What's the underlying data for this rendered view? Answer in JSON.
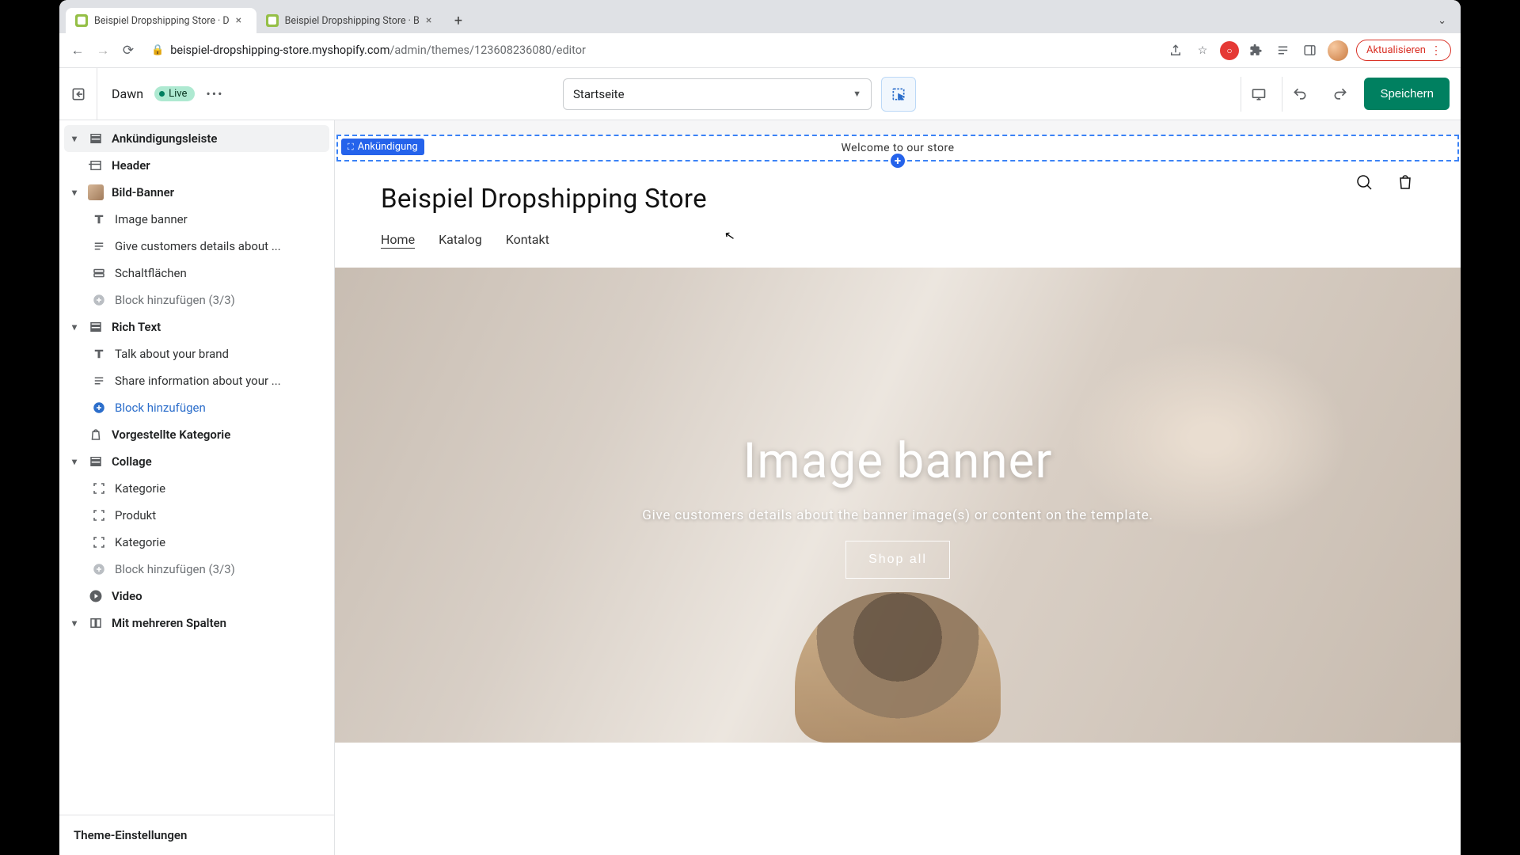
{
  "browser": {
    "tabs": [
      {
        "title": "Beispiel Dropshipping Store · D",
        "active": true
      },
      {
        "title": "Beispiel Dropshipping Store · B",
        "active": false
      }
    ],
    "url_domain": "beispiel-dropshipping-store.myshopify.com",
    "url_path": "/admin/themes/123608236080/editor",
    "update_label": "Aktualisieren"
  },
  "topbar": {
    "theme_name": "Dawn",
    "status_label": "Live",
    "page_selector": "Startseite",
    "save_label": "Speichern"
  },
  "sidebar": {
    "sections": [
      {
        "kind": "section",
        "label": "Ankündigungsleiste",
        "icon": "rows",
        "chev": "down",
        "selected": true
      },
      {
        "kind": "section",
        "label": "Header",
        "icon": "header",
        "chev": "none"
      },
      {
        "kind": "section",
        "label": "Bild-Banner",
        "icon": "image",
        "chev": "down",
        "image_badge": true
      },
      {
        "kind": "block",
        "label": "Image banner",
        "icon": "text"
      },
      {
        "kind": "block",
        "label": "Give customers details about ...",
        "icon": "lines"
      },
      {
        "kind": "block",
        "label": "Schaltflächen",
        "icon": "buttons"
      },
      {
        "kind": "add",
        "label": "Block hinzufügen (3/3)",
        "icon": "plus-grey"
      },
      {
        "kind": "section",
        "label": "Rich Text",
        "icon": "rows",
        "chev": "down"
      },
      {
        "kind": "block",
        "label": "Talk about your brand",
        "icon": "text"
      },
      {
        "kind": "block",
        "label": "Share information about your ...",
        "icon": "lines"
      },
      {
        "kind": "addblue",
        "label": "Block hinzufügen",
        "icon": "plus-blue"
      },
      {
        "kind": "section",
        "label": "Vorgestellte Kategorie",
        "icon": "bag",
        "chev": "none"
      },
      {
        "kind": "section",
        "label": "Collage",
        "icon": "rows",
        "chev": "down"
      },
      {
        "kind": "block",
        "label": "Kategorie",
        "icon": "frame"
      },
      {
        "kind": "block",
        "label": "Produkt",
        "icon": "frame"
      },
      {
        "kind": "block",
        "label": "Kategorie",
        "icon": "frame"
      },
      {
        "kind": "add",
        "label": "Block hinzufügen (3/3)",
        "icon": "plus-grey"
      },
      {
        "kind": "section",
        "label": "Video",
        "icon": "play",
        "chev": "none"
      },
      {
        "kind": "section",
        "label": "Mit mehreren Spalten",
        "icon": "columns",
        "chev": "down"
      }
    ],
    "footer_label": "Theme-Einstellungen"
  },
  "preview": {
    "announcement_tag": "Ankündigung",
    "announcement_text": "Welcome to our store",
    "store_name": "Beispiel Dropshipping Store",
    "menu": [
      "Home",
      "Katalog",
      "Kontakt"
    ],
    "banner_title": "Image banner",
    "banner_subtitle": "Give customers details about the banner image(s) or content on the template.",
    "banner_button": "Shop all"
  }
}
